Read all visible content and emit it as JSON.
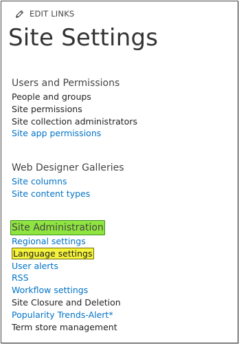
{
  "edit_links": {
    "label": "EDIT LINKS",
    "icon": "pencil-icon"
  },
  "page": {
    "title": "Site Settings"
  },
  "sections": {
    "users_permissions": {
      "title": "Users and Permissions",
      "links": [
        "People and groups",
        "Site permissions",
        "Site collection administrators",
        "Site app permissions"
      ]
    },
    "web_designer": {
      "title": "Web Designer Galleries",
      "links": [
        "Site columns",
        "Site content types"
      ]
    },
    "site_administration": {
      "title": "Site Administration",
      "links": [
        "Regional settings",
        "Language settings",
        "User alerts",
        "RSS",
        "Workflow settings",
        "Site Closure and Deletion",
        "Popularity Trends-Alert*",
        "Term store management"
      ]
    }
  },
  "colors": {
    "link_blue": "#0072c6",
    "link_dark": "#222222",
    "highlight_green": "#8ee53f",
    "highlight_yellow": "#f6f33b"
  }
}
